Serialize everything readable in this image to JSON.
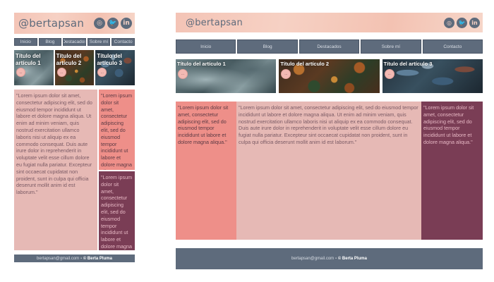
{
  "header": {
    "brand": "@bertapsan",
    "socials": [
      {
        "icon": "instagram-icon",
        "glyph": "◎"
      },
      {
        "icon": "twitter-icon",
        "glyph": "🐦"
      },
      {
        "icon": "linkedin-icon",
        "glyph": "in"
      }
    ]
  },
  "nav": {
    "items": [
      {
        "label": "Inicio"
      },
      {
        "label": "Blog"
      },
      {
        "label": "Destacados"
      },
      {
        "label": "Sobre mí"
      },
      {
        "label": "Contacto"
      }
    ]
  },
  "articles": [
    {
      "title": "Título del artículo 1",
      "badge": "..."
    },
    {
      "title": "Título del artículo 2",
      "badge": "..."
    },
    {
      "title": "Título del artículo 3",
      "badge": "..."
    }
  ],
  "content": {
    "main_text": "\"Lorem ipsum dolor sit amet, consectetur adipiscing elit, sed do eiusmod tempor incididunt ut labore et dolore magna aliqua. Ut enim ad minim veniam, quis nostrud exercitation ullamco laboris nisi ut aliquip ex ea commodo consequat. Duis aute irure dolor in reprehenderit in voluptate velit esse cillum dolore eu fugiat nulla pariatur. Excepteur sint occaecat cupidatat non proident, sunt in culpa qui officia deserunt mollit anim id est laborum.\"",
    "red_text": "\"Lorem ipsum dolor sit amet, consectetur adipiscing elit, sed do eiusmod tempor incididunt ut labore et dolore magna aliqua.\"",
    "wine_text": "\"Lorem ipsum dolor sit amet, consectetur adipiscing elit, sed do eiusmod tempor incididunt ut labore et dolore magna aliqua.\""
  },
  "footer": {
    "email": "bertapsan@gmail.com",
    "copyright": "- © Berta Pluma"
  },
  "colors": {
    "nav": "#5e6b7c",
    "main_column": "#e6b9b5",
    "red_column": "#ee8f89",
    "wine_column": "#7a3d55",
    "header_gradient": "#f4c4b6"
  }
}
